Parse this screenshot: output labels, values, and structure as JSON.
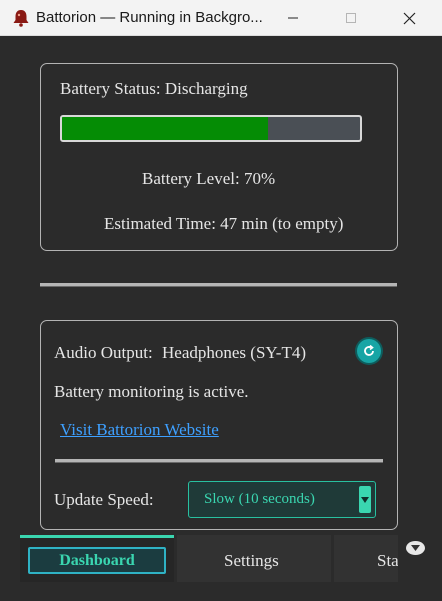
{
  "window": {
    "title": "Battorion — Running in Backgro..."
  },
  "battery": {
    "status_label": "Battery Status: Discharging",
    "level_label": "Battery Level: 70%",
    "level_fraction": 0.69,
    "estimated_time": "Estimated Time: 47 min (to empty)",
    "bar_color": "#058c05"
  },
  "audio": {
    "output_label": "Audio Output:",
    "output_device": "Headphones (SY-T4)",
    "monitoring_status": "Battery monitoring is active.",
    "website_link": "Visit Battorion Website",
    "update_speed_label": "Update Speed:",
    "update_speed_value": "Slow (10 seconds)"
  },
  "tabs": [
    {
      "label": "Dashboard",
      "active": true
    },
    {
      "label": "Settings",
      "active": false
    },
    {
      "label": "Sta",
      "active": false
    }
  ],
  "icons": {
    "app": "bell-icon",
    "refresh": "refresh-icon",
    "dropdown": "chevron-down-icon",
    "scroll": "chevron-down-icon"
  },
  "colors": {
    "accent": "#3ad6b0",
    "link": "#3ea0ff"
  }
}
